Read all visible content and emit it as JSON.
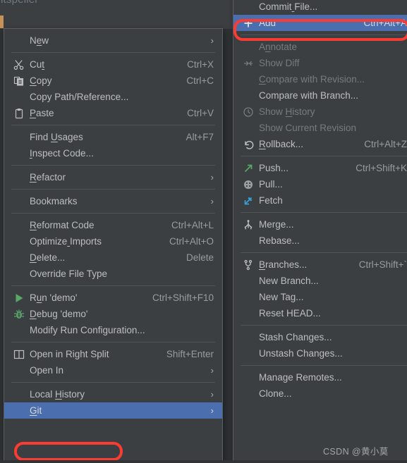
{
  "editor": {
    "cut_off_text": "ntspeller",
    "watermark": "CSDN @黄小莫"
  },
  "context_menu": {
    "name": "file-context-menu",
    "groups": [
      {
        "items": [
          {
            "label": "New",
            "accel": "",
            "arrow": "›",
            "icon": "",
            "disabled": false,
            "selected": false
          }
        ]
      },
      {
        "items": [
          {
            "label": "Cut",
            "accel": "Ctrl+X",
            "arrow": "",
            "icon": "scissors-icon",
            "disabled": false,
            "selected": false
          },
          {
            "label": "Copy",
            "accel": "Ctrl+C",
            "arrow": "",
            "icon": "copy-icon",
            "disabled": false,
            "selected": false
          },
          {
            "label": "Copy Path/Reference...",
            "accel": "",
            "arrow": "",
            "icon": "",
            "disabled": false,
            "selected": false
          },
          {
            "label": "Paste",
            "accel": "Ctrl+V",
            "arrow": "",
            "icon": "clipboard-icon",
            "disabled": false,
            "selected": false
          }
        ]
      },
      {
        "items": [
          {
            "label": "Find Usages",
            "accel": "Alt+F7",
            "arrow": "",
            "icon": "",
            "disabled": false,
            "selected": false
          },
          {
            "label": "Inspect Code...",
            "accel": "",
            "arrow": "",
            "icon": "",
            "disabled": false,
            "selected": false
          }
        ]
      },
      {
        "items": [
          {
            "label": "Refactor",
            "accel": "",
            "arrow": "›",
            "icon": "",
            "disabled": false,
            "selected": false
          }
        ]
      },
      {
        "items": [
          {
            "label": "Bookmarks",
            "accel": "",
            "arrow": "›",
            "icon": "",
            "disabled": false,
            "selected": false
          }
        ]
      },
      {
        "items": [
          {
            "label": "Reformat Code",
            "accel": "Ctrl+Alt+L",
            "arrow": "",
            "icon": "",
            "disabled": false,
            "selected": false
          },
          {
            "label": "Optimize Imports",
            "accel": "Ctrl+Alt+O",
            "arrow": "",
            "icon": "",
            "disabled": false,
            "selected": false
          },
          {
            "label": "Delete...",
            "accel": "Delete",
            "arrow": "",
            "icon": "",
            "disabled": false,
            "selected": false
          },
          {
            "label": "Override File Type",
            "accel": "",
            "arrow": "",
            "icon": "",
            "disabled": false,
            "selected": false
          }
        ]
      },
      {
        "items": [
          {
            "label": "Run 'demo'",
            "accel": "Ctrl+Shift+F10",
            "arrow": "",
            "icon": "run-icon",
            "disabled": false,
            "selected": false
          },
          {
            "label": "Debug 'demo'",
            "accel": "",
            "arrow": "",
            "icon": "debug-icon",
            "disabled": false,
            "selected": false
          },
          {
            "label": "Modify Run Configuration...",
            "accel": "",
            "arrow": "",
            "icon": "",
            "disabled": false,
            "selected": false
          }
        ]
      },
      {
        "items": [
          {
            "label": "Open in Right Split",
            "accel": "Shift+Enter",
            "arrow": "",
            "icon": "split-icon",
            "disabled": false,
            "selected": false
          },
          {
            "label": "Open In",
            "accel": "",
            "arrow": "›",
            "icon": "",
            "disabled": false,
            "selected": false
          }
        ]
      },
      {
        "items": [
          {
            "label": "Local History",
            "accel": "",
            "arrow": "›",
            "icon": "",
            "disabled": false,
            "selected": false
          },
          {
            "label": "Git",
            "accel": "",
            "arrow": "›",
            "icon": "",
            "disabled": false,
            "selected": true
          }
        ]
      }
    ]
  },
  "git_menu": {
    "name": "git-submenu",
    "groups": [
      {
        "items": [
          {
            "label": "Commit File...",
            "accel": "",
            "arrow": "",
            "icon": "",
            "disabled": false,
            "selected": false
          },
          {
            "label": "Add",
            "accel": "Ctrl+Alt+A",
            "arrow": "",
            "icon": "plus-icon",
            "disabled": false,
            "selected": true
          }
        ]
      },
      {
        "items": [
          {
            "label": "Annotate",
            "accel": "",
            "arrow": "",
            "icon": "",
            "disabled": true,
            "selected": false
          },
          {
            "label": "Show Diff",
            "accel": "",
            "arrow": "",
            "icon": "diff-icon",
            "disabled": true,
            "selected": false
          },
          {
            "label": "Compare with Revision...",
            "accel": "",
            "arrow": "",
            "icon": "",
            "disabled": true,
            "selected": false
          },
          {
            "label": "Compare with Branch...",
            "accel": "",
            "arrow": "",
            "icon": "",
            "disabled": false,
            "selected": false
          },
          {
            "label": "Show History",
            "accel": "",
            "arrow": "",
            "icon": "clock-icon",
            "disabled": true,
            "selected": false
          },
          {
            "label": "Show Current Revision",
            "accel": "",
            "arrow": "",
            "icon": "",
            "disabled": true,
            "selected": false
          },
          {
            "label": "Rollback...",
            "accel": "Ctrl+Alt+Z",
            "arrow": "",
            "icon": "rollback-icon",
            "disabled": false,
            "selected": false
          }
        ]
      },
      {
        "items": [
          {
            "label": "Push...",
            "accel": "Ctrl+Shift+K",
            "arrow": "",
            "icon": "push-icon",
            "disabled": false,
            "selected": false
          },
          {
            "label": "Pull...",
            "accel": "",
            "arrow": "",
            "icon": "pull-icon",
            "disabled": false,
            "selected": false
          },
          {
            "label": "Fetch",
            "accel": "",
            "arrow": "",
            "icon": "fetch-icon",
            "disabled": false,
            "selected": false
          }
        ]
      },
      {
        "items": [
          {
            "label": "Merge...",
            "accel": "",
            "arrow": "",
            "icon": "merge-icon",
            "disabled": false,
            "selected": false
          },
          {
            "label": "Rebase...",
            "accel": "",
            "arrow": "",
            "icon": "",
            "disabled": false,
            "selected": false
          }
        ]
      },
      {
        "items": [
          {
            "label": "Branches...",
            "accel": "Ctrl+Shift+`",
            "arrow": "",
            "icon": "branch-icon",
            "disabled": false,
            "selected": false
          },
          {
            "label": "New Branch...",
            "accel": "",
            "arrow": "",
            "icon": "",
            "disabled": false,
            "selected": false
          },
          {
            "label": "New Tag...",
            "accel": "",
            "arrow": "",
            "icon": "",
            "disabled": false,
            "selected": false
          },
          {
            "label": "Reset HEAD...",
            "accel": "",
            "arrow": "",
            "icon": "",
            "disabled": false,
            "selected": false
          }
        ]
      },
      {
        "items": [
          {
            "label": "Stash Changes...",
            "accel": "",
            "arrow": "",
            "icon": "",
            "disabled": false,
            "selected": false
          },
          {
            "label": "Unstash Changes...",
            "accel": "",
            "arrow": "",
            "icon": "",
            "disabled": false,
            "selected": false
          }
        ]
      },
      {
        "items": [
          {
            "label": "Manage Remotes...",
            "accel": "",
            "arrow": "",
            "icon": "",
            "disabled": false,
            "selected": false
          },
          {
            "label": "Clone...",
            "accel": "",
            "arrow": "",
            "icon": "",
            "disabled": false,
            "selected": false
          }
        ]
      }
    ]
  },
  "annotations": {
    "add_highlight_color": "#fc3b33",
    "git_highlight_color": "#fc3b33",
    "selection_color": "#4b6eaf"
  },
  "mnemonics": {
    "New": 1,
    "Cut": 2,
    "Copy": 0,
    "Paste": 0,
    "Find Usages": 5,
    "Inspect Code...": 0,
    "Refactor": 0,
    "Reformat Code": 0,
    "Optimize Imports": 8,
    "Delete...": 0,
    "Run 'demo'": 1,
    "Debug 'demo'": 0,
    "Local History": 6,
    "Git": 0,
    "Commit File...": 6,
    "Annotate": 1,
    "Compare with Revision...": 0,
    "Rollback...": 0,
    "Branches...": 0,
    "Show History": 5
  }
}
